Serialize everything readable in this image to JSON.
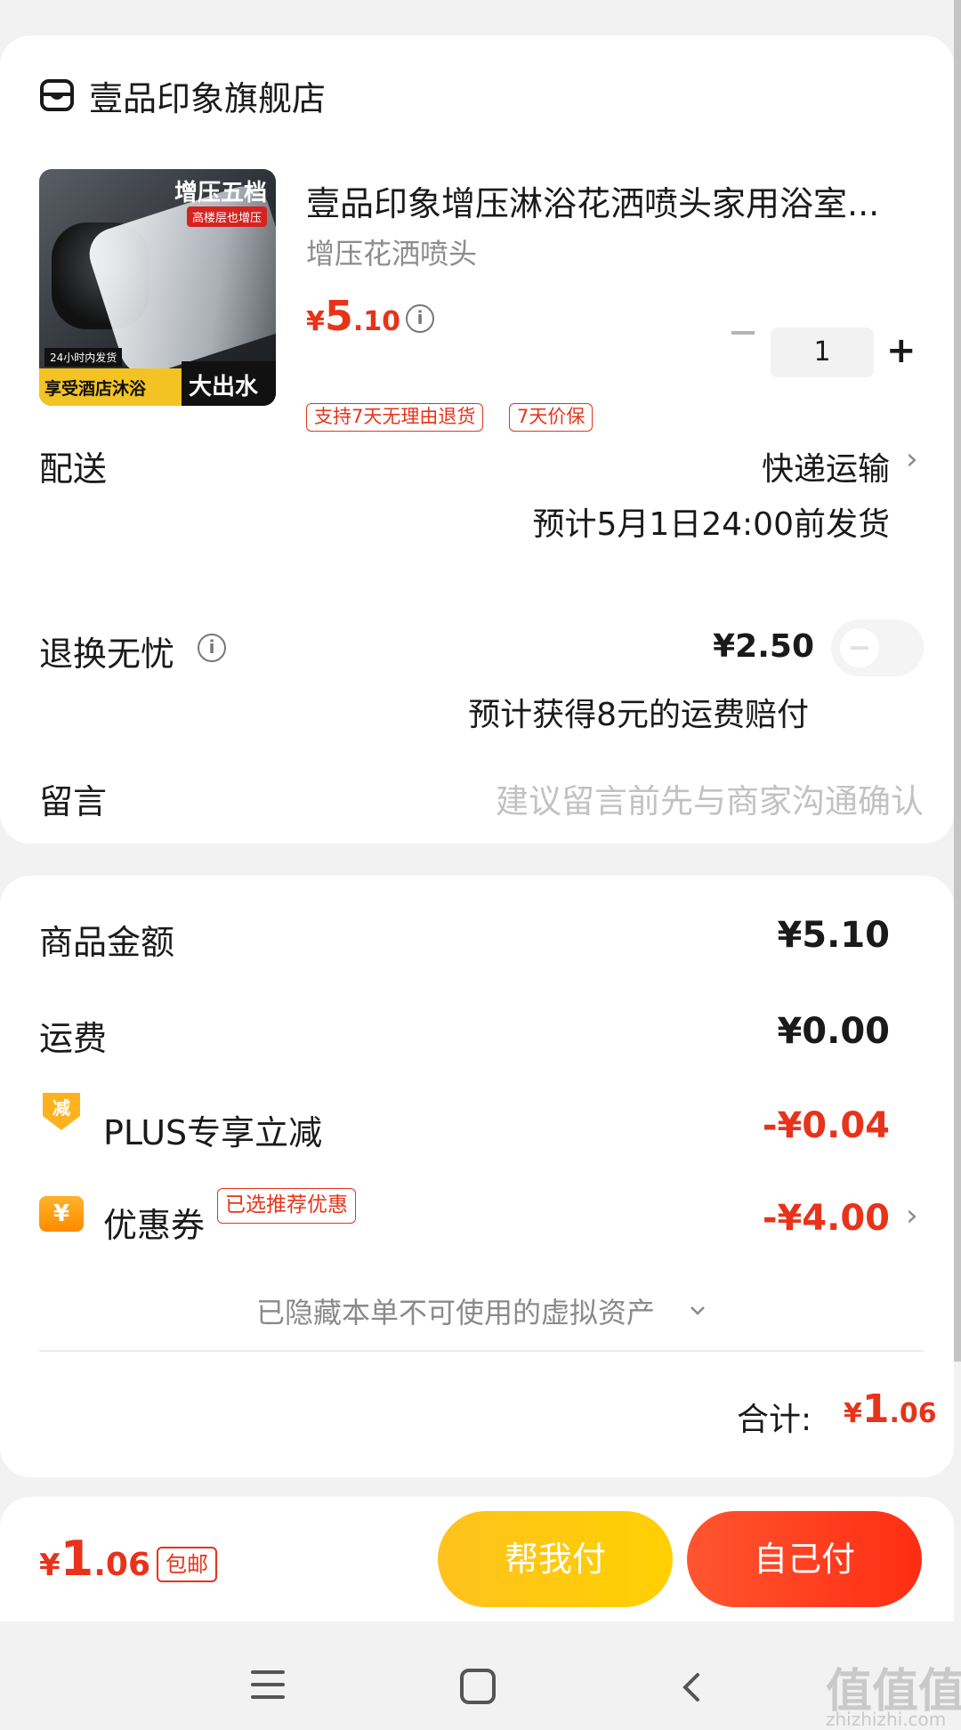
{
  "store": {
    "name": "壹品印象旗舰店",
    "product": {
      "title": "壹品印象增压淋浴花洒喷头家用浴室...",
      "spec": "增压花洒喷头",
      "price_symbol": "¥",
      "price_int": "5",
      "price_dec": ".10",
      "quantity": "1",
      "tags": [
        "支持7天无理由退货",
        "7天价保"
      ],
      "image_texts": [
        "增压五档",
        "高楼层也增压",
        "24小时内发货",
        "享受酒店沐浴",
        "大出水"
      ]
    },
    "delivery": {
      "label": "配送",
      "method": "快递运输",
      "estimate": "预计5月1日24:00前发货"
    },
    "return_worry_free": {
      "label": "退换无忧",
      "price": "¥2.50",
      "note": "预计获得8元的运费赔付",
      "enabled": false
    },
    "message": {
      "label": "留言",
      "placeholder": "建议留言前先与商家沟通确认"
    }
  },
  "summary": {
    "goods_amount_label": "商品金额",
    "goods_amount": "¥5.10",
    "shipping_label": "运费",
    "shipping": "¥0.00",
    "plus_badge": "减",
    "plus_label": "PLUS专享立减",
    "plus_discount": "-¥0.04",
    "coupon_badge": "¥",
    "coupon_label": "优惠券",
    "coupon_tag": "已选推荐优惠",
    "coupon_discount": "-¥4.00",
    "hidden_assets": "已隐藏本单不可使用的虚拟资产",
    "total_label": "合计:",
    "total_symbol": "¥",
    "total_int": "1",
    "total_dec": ".06"
  },
  "bottom_bar": {
    "amount_symbol": "¥",
    "amount_int": "1",
    "amount_dec": ".06",
    "postage_tag": "包邮",
    "help_pay": "帮我付",
    "self_pay": "自己付"
  },
  "watermark": {
    "main": "值值值",
    "sub": "zhizhizhi.com"
  },
  "colors": {
    "accent_red": "#e8331b",
    "help_pay_yellow": "#ffc21e",
    "self_pay_red": "#ff3a1c"
  }
}
